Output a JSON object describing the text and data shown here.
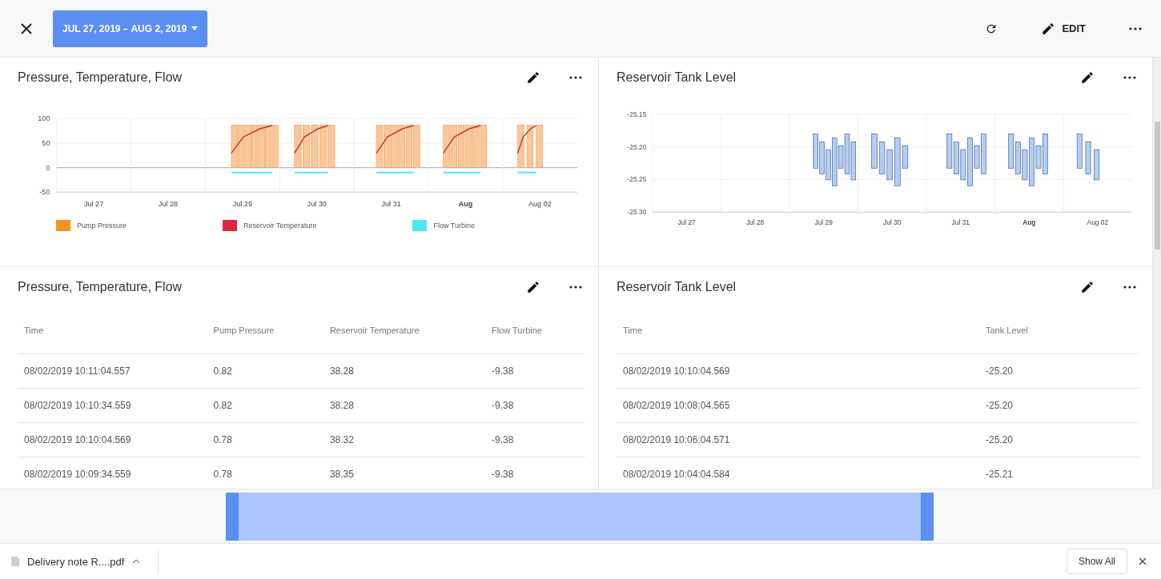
{
  "toolbar": {
    "date_range": "JUL 27, 2019 – AUG 2, 2019",
    "edit_label": "EDIT"
  },
  "charts": [
    {
      "title": "Pressure, Temperature, Flow",
      "y_ticks": [
        "100",
        "50",
        "0",
        "-50"
      ],
      "x_ticks": [
        {
          "label": "Jul 27",
          "bold": false
        },
        {
          "label": "Jul 28",
          "bold": false
        },
        {
          "label": "Jul 29",
          "bold": false
        },
        {
          "label": "Jul 30",
          "bold": false
        },
        {
          "label": "Jul 31",
          "bold": false
        },
        {
          "label": "Aug",
          "bold": true
        },
        {
          "label": "Aug 02",
          "bold": false
        }
      ],
      "legend": [
        {
          "label": "Pump Pressure",
          "color": "#f7941d"
        },
        {
          "label": "Reservoir Temperature",
          "color": "#dc2a3c"
        },
        {
          "label": "Flow Turbine",
          "color": "#4ee8f0"
        }
      ]
    },
    {
      "title": "Reservoir Tank Level",
      "y_ticks": [
        "-25.15",
        "-25.20",
        "-25.25",
        "-25.30"
      ],
      "x_ticks": [
        {
          "label": "Jul 27",
          "bold": false
        },
        {
          "label": "Jul 28",
          "bold": false
        },
        {
          "label": "Jul 29",
          "bold": false
        },
        {
          "label": "Jul 30",
          "bold": false
        },
        {
          "label": "Jul 31",
          "bold": false
        },
        {
          "label": "Aug",
          "bold": true
        },
        {
          "label": "Aug 02",
          "bold": false
        }
      ]
    }
  ],
  "tables": [
    {
      "title": "Pressure, Temperature, Flow",
      "columns": [
        "Time",
        "Pump Pressure",
        "Reservoir Temperature",
        "Flow Turbine"
      ],
      "rows": [
        [
          "08/02/2019 10:11:04.557",
          "0.82",
          "38.28",
          "-9.38"
        ],
        [
          "08/02/2019 10:10:34.559",
          "0.82",
          "38.28",
          "-9.38"
        ],
        [
          "08/02/2019 10:10:04.569",
          "0.78",
          "38.32",
          "-9.38"
        ],
        [
          "08/02/2019 10:09:34.559",
          "0.78",
          "38.35",
          "-9.38"
        ]
      ]
    },
    {
      "title": "Reservoir Tank Level",
      "columns": [
        "Time",
        "Tank Level"
      ],
      "rows": [
        [
          "08/02/2019 10:10:04.569",
          "-25.20"
        ],
        [
          "08/02/2019 10:08:04.565",
          "-25.20"
        ],
        [
          "08/02/2019 10:06:04.571",
          "-25.20"
        ],
        [
          "08/02/2019 10:04:04.584",
          "-25.21"
        ]
      ]
    }
  ],
  "download_bar": {
    "file": "Delivery note R....pdf",
    "show_all": "Show All"
  }
}
